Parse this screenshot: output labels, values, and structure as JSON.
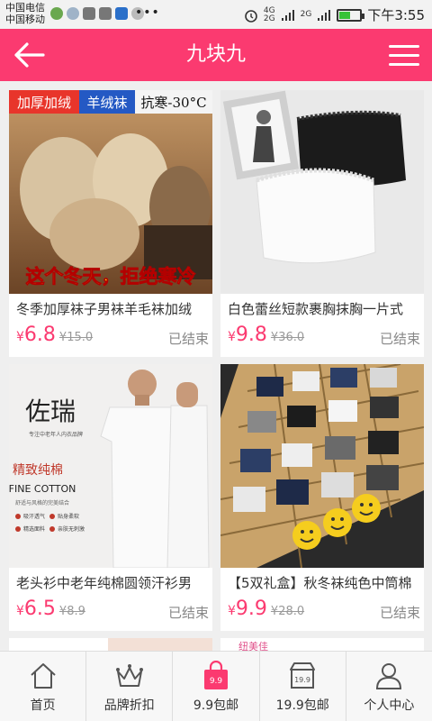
{
  "status_bar": {
    "carrier1": "中国电信",
    "carrier2": "中国移动",
    "dots": "•••",
    "net_top": "4G",
    "net_bottom": "2G",
    "net2": "2G",
    "time": "下午3:55",
    "battery_level": 0.55,
    "battery_color": "#36c236"
  },
  "header": {
    "title": "九块九",
    "back_icon": "arrow-left-icon",
    "menu_icon": "hamburger-menu-icon",
    "bg_color": "#fb3a70"
  },
  "products": [
    {
      "title": "冬季加厚袜子男袜羊毛袜加绒",
      "currency": "¥",
      "price": "6.8",
      "old_price": "¥15.0",
      "status": "已结束",
      "banner_top": [
        "加厚加绒",
        "羊绒袜",
        "抗寒-30°C"
      ],
      "banner_bottom": "这个冬天，拒绝寒冷"
    },
    {
      "title": "白色蕾丝短款裹胸抹胸一片式",
      "currency": "¥",
      "price": "9.8",
      "old_price": "¥36.0",
      "status": "已结束"
    },
    {
      "title": "老头衫中老年纯棉圆领汗衫男",
      "currency": "¥",
      "price": "6.5",
      "old_price": "¥8.9",
      "status": "已结束",
      "brand": "佐瑞",
      "brand_sub": "专注中老年人内衣品牌",
      "cotton_cn": "精致纯棉",
      "cotton_en": "FINE COTTON",
      "cotton_sub": "舒适与风格的完美结合",
      "features": [
        "吸汗透气",
        "贴身柔软",
        "精选面料",
        "亲肤无刺激"
      ]
    },
    {
      "title": "【5双礼盒】秋冬袜纯色中筒棉",
      "currency": "¥",
      "price": "9.9",
      "old_price": "¥28.0",
      "status": "已结束"
    },
    {
      "partial_text": "纽美佳"
    }
  ],
  "tabs": [
    {
      "label": "首页",
      "icon": "home-icon"
    },
    {
      "label": "品牌折扣",
      "icon": "crown-icon"
    },
    {
      "label": "9.9包邮",
      "icon": "shopping-bag-icon",
      "badge": "9.9",
      "active_color": "#fb3a70"
    },
    {
      "label": "19.9包邮",
      "icon": "shop-icon",
      "badge": "19.9"
    },
    {
      "label": "个人中心",
      "icon": "user-icon"
    }
  ]
}
